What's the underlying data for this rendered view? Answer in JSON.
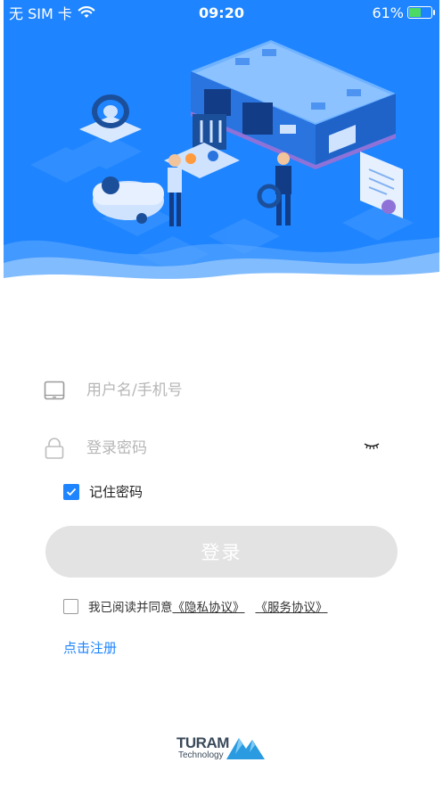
{
  "status_bar": {
    "carrier": "无 SIM 卡",
    "time": "09:20",
    "battery": "61%",
    "battery_level": 0.61,
    "charging_color": "#4cd964"
  },
  "hero": {
    "description_icon": "garage-illustration",
    "background_color": "#1e84ff"
  },
  "form": {
    "username": {
      "placeholder": "用户名/手机号",
      "value": "",
      "icon": "phone-icon"
    },
    "password": {
      "placeholder": "登录密码",
      "value": "",
      "icon": "lock-icon",
      "toggle_icon": "eye-closed-icon"
    },
    "remember": {
      "label": "记住密码",
      "checked": true
    }
  },
  "login_button": {
    "label": "登录",
    "enabled": false
  },
  "agreement": {
    "checked": false,
    "prefix": "我已阅读并同意",
    "privacy_link": "《隐私协议》",
    "service_link": "《服务协议》"
  },
  "register_link": "点击注册",
  "logo": {
    "word": "TURAM",
    "sub": "Technology"
  },
  "colors": {
    "accent": "#1e84ff",
    "button_disabled": "#e3e3e3"
  }
}
